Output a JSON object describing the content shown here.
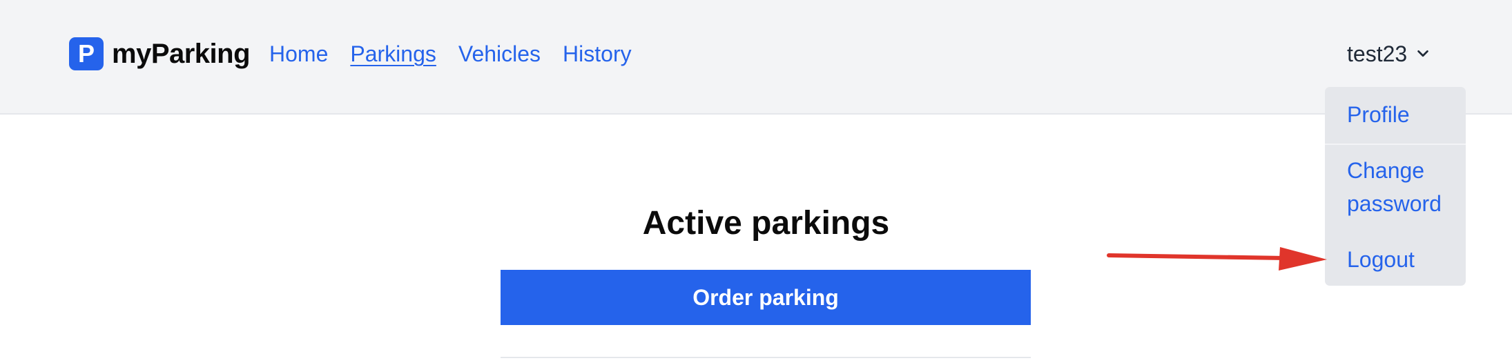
{
  "brand": {
    "logo_letter": "P",
    "name": "myParking"
  },
  "nav": {
    "items": [
      {
        "label": "Home"
      },
      {
        "label": "Parkings"
      },
      {
        "label": "Vehicles"
      },
      {
        "label": "History"
      }
    ],
    "active": "Parkings"
  },
  "user_menu": {
    "username": "test23",
    "toggle_icon": "chevron-down-icon",
    "items": [
      {
        "label": "Profile"
      },
      {
        "label": "Change password"
      },
      {
        "label": "Logout"
      }
    ]
  },
  "main": {
    "title": "Active parkings",
    "order_button_label": "Order parking"
  },
  "annotation": {
    "arrow_color": "#e0352b",
    "points_to": "Logout"
  },
  "colors": {
    "accent": "#2563eb",
    "header_bg": "#f3f4f6",
    "dropdown_bg": "#e5e7eb"
  }
}
